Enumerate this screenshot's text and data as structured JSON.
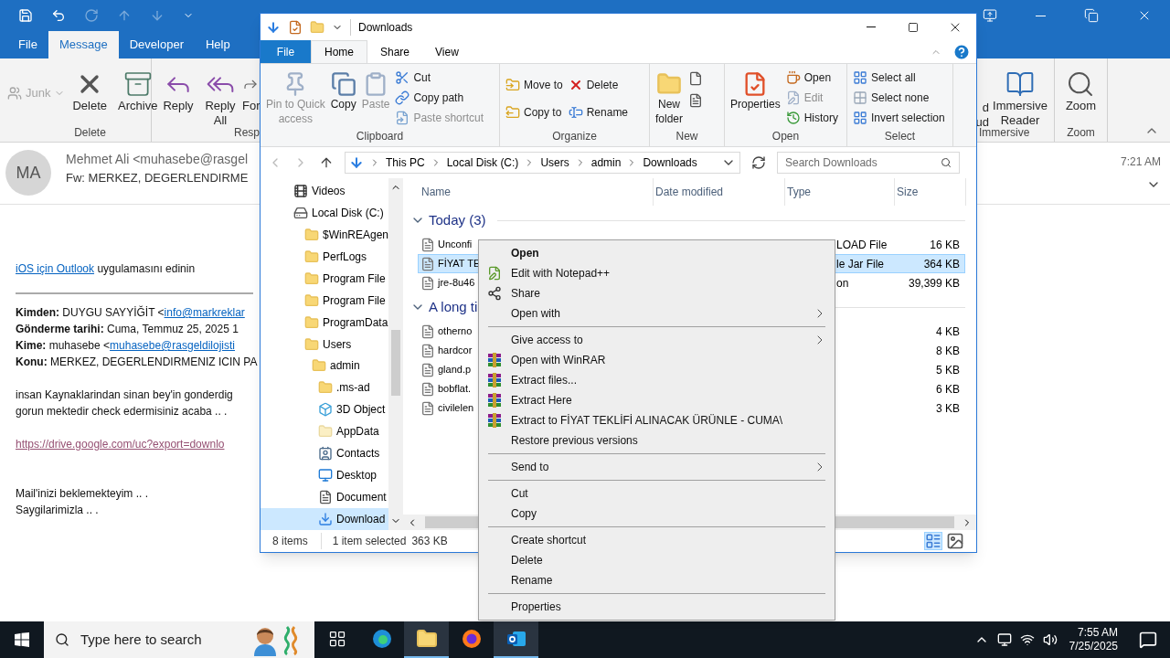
{
  "outlook": {
    "tabs": [
      {
        "label": "File",
        "selected": false
      },
      {
        "label": "Message",
        "selected": true
      },
      {
        "label": "Developer",
        "selected": false
      },
      {
        "label": "Help",
        "selected": false
      }
    ],
    "junk": {
      "label": "Junk",
      "disabled": true
    },
    "delete_group": {
      "buttons": [
        {
          "lines": [
            "Delete"
          ]
        },
        {
          "lines": [
            "Archive"
          ]
        }
      ],
      "label": "Delete"
    },
    "respond_group": {
      "buttons": [
        {
          "lines": [
            "Reply"
          ]
        },
        {
          "lines": [
            "Reply",
            "All"
          ]
        },
        {
          "lines": [
            "For"
          ]
        }
      ],
      "label": "Resp"
    },
    "immersive_group": {
      "buttons": [
        {
          "lines": [
            "d",
            "ud"
          ]
        },
        {
          "lines": [
            "Immersive",
            "Reader"
          ]
        }
      ],
      "label": "Immersive"
    },
    "zoom_group": {
      "buttons": [
        {
          "lines": [
            "Zoom"
          ]
        }
      ],
      "label": "Zoom"
    },
    "message": {
      "avatar": "MA",
      "from": "Mehmet Ali <muhasebe@rasgel",
      "subject": "Fw: MERKEZ, DEGERLENDIRME",
      "time": "7:21 AM"
    },
    "body": {
      "app_link": "iOS için Outlook",
      "app_text": " uygulamasını edinin",
      "headers": [
        {
          "label": "Kimden:",
          "text": " DUYGU SAYYİĞİT <",
          "link": "info@markreklar"
        },
        {
          "label": "Gönderme tarihi:",
          "text": " Cuma, Temmuz 25, 2025 1"
        },
        {
          "label": "Kime:",
          "text": " muhasebe <",
          "link": "muhasebe@rasgeldilojisti"
        },
        {
          "label": "Konu:",
          "text": " MERKEZ, DEGERLENDIRMENIZ ICIN PA"
        }
      ],
      "paragraph": [
        "insan Kaynaklarindan sinan bey'in gonderdig",
        "gorun mektedir check edermisiniz acaba .. ."
      ],
      "url": "https://drive.google.com/uc?export=downlo",
      "closing": [
        "Mail'inizi beklemekteyim .. .",
        "Saygilarimizla .. ."
      ]
    }
  },
  "explorer": {
    "title": "Downloads",
    "file_menu": "File",
    "tabs": [
      {
        "label": "Home",
        "selected": true
      },
      {
        "label": "Share",
        "selected": false
      },
      {
        "label": "View",
        "selected": false
      }
    ],
    "clipboard": {
      "label": "Clipboard",
      "large": [
        {
          "lines": [
            "Pin to Quick",
            "access"
          ],
          "disabled": true
        },
        {
          "lines": [
            "Copy"
          ],
          "disabled": false
        },
        {
          "lines": [
            "Paste"
          ],
          "disabled": true
        }
      ],
      "small": [
        {
          "label": "Cut",
          "disabled": false
        },
        {
          "label": "Copy path",
          "disabled": false
        },
        {
          "label": "Paste shortcut",
          "disabled": true
        }
      ]
    },
    "organize": {
      "label": "Organize",
      "small": [
        {
          "label": "Move to",
          "disabled": false
        },
        {
          "label": "Copy to",
          "disabled": false
        },
        {
          "label": "Delete",
          "disabled": false
        },
        {
          "label": "Rename",
          "disabled": false
        }
      ]
    },
    "new": {
      "label": "New",
      "button": [
        "New",
        "folder"
      ]
    },
    "open": {
      "label": "Open",
      "button": [
        "Properties"
      ],
      "small": [
        {
          "label": "Open",
          "disabled": false
        },
        {
          "label": "Edit",
          "disabled": true
        },
        {
          "label": "History",
          "disabled": false
        }
      ]
    },
    "select": {
      "label": "Select",
      "small": [
        {
          "label": "Select all",
          "disabled": false
        },
        {
          "label": "Select none",
          "disabled": false
        },
        {
          "label": "Invert selection",
          "disabled": false
        }
      ]
    },
    "breadcrumb": [
      "This PC",
      "Local Disk (C:)",
      "Users",
      "admin",
      "Downloads"
    ],
    "search": {
      "placeholder": "Search Downloads"
    },
    "nav": [
      {
        "label": "Videos",
        "selected": false
      },
      {
        "label": "Local Disk (C:)",
        "selected": false,
        "children": [
          {
            "label": "$WinREAgen",
            "selected": false
          },
          {
            "label": "PerfLogs",
            "selected": false
          },
          {
            "label": "Program File",
            "selected": false
          },
          {
            "label": "Program File",
            "selected": false
          },
          {
            "label": "ProgramData",
            "selected": false
          },
          {
            "label": "Users",
            "selected": false,
            "children": [
              {
                "label": "admin",
                "selected": false,
                "children": [
                  {
                    "label": ".ms-ad",
                    "selected": false
                  },
                  {
                    "label": "3D Object",
                    "selected": false
                  },
                  {
                    "label": "AppData",
                    "selected": false
                  },
                  {
                    "label": "Contacts",
                    "selected": false
                  },
                  {
                    "label": "Desktop",
                    "selected": false
                  },
                  {
                    "label": "Document",
                    "selected": false
                  },
                  {
                    "label": "Download",
                    "selected": true
                  }
                ]
              }
            ]
          }
        ]
      }
    ],
    "columns": [
      "Name",
      "Date modified",
      "Type",
      "Size"
    ],
    "groups": [
      {
        "label": "Today (3)",
        "files": [
          {
            "name": "Unconfi",
            "type": "LOAD File",
            "size": "16 KB",
            "selected": false
          },
          {
            "name": "FİYAT TE",
            "type": "le Jar File",
            "size": "364 KB",
            "selected": true
          },
          {
            "name": "jre-8u46",
            "type": "on",
            "size": "39,399 KB",
            "selected": false
          }
        ]
      },
      {
        "label": "A long ti",
        "files": [
          {
            "name": "otherno",
            "size": "4 KB",
            "selected": false
          },
          {
            "name": "hardcor",
            "size": "8 KB",
            "selected": false
          },
          {
            "name": "gland.p",
            "size": "5 KB",
            "selected": false
          },
          {
            "name": "bobflat.",
            "size": "6 KB",
            "selected": false
          },
          {
            "name": "civilelen",
            "size": "3 KB",
            "selected": false
          }
        ]
      }
    ],
    "status": {
      "count": "8 items",
      "selection": "1 item selected",
      "size": "363 KB"
    }
  },
  "context_menu": [
    {
      "kind": "item",
      "label": "Open",
      "bold": true
    },
    {
      "kind": "item",
      "label": "Edit with Notepad++"
    },
    {
      "kind": "item",
      "label": "Share"
    },
    {
      "kind": "submenu",
      "label": "Open with"
    },
    {
      "kind": "separator"
    },
    {
      "kind": "submenu",
      "label": "Give access to"
    },
    {
      "kind": "item",
      "label": "Open with WinRAR"
    },
    {
      "kind": "item",
      "label": "Extract files..."
    },
    {
      "kind": "item",
      "label": "Extract Here"
    },
    {
      "kind": "item",
      "label": "Extract to FİYAT TEKLİFİ ALINACAK ÜRÜNLE - CUMA\\"
    },
    {
      "kind": "item",
      "label": "Restore previous versions"
    },
    {
      "kind": "separator"
    },
    {
      "kind": "submenu",
      "label": "Send to"
    },
    {
      "kind": "separator"
    },
    {
      "kind": "item",
      "label": "Cut"
    },
    {
      "kind": "item",
      "label": "Copy"
    },
    {
      "kind": "separator"
    },
    {
      "kind": "item",
      "label": "Create shortcut"
    },
    {
      "kind": "item",
      "label": "Delete"
    },
    {
      "kind": "item",
      "label": "Rename"
    },
    {
      "kind": "separator"
    },
    {
      "kind": "item",
      "label": "Properties"
    }
  ],
  "taskbar": {
    "search_placeholder": "Type here to search",
    "apps": [
      {
        "selected": false
      },
      {
        "selected": false
      },
      {
        "selected": true
      },
      {
        "selected": false
      },
      {
        "selected": true
      }
    ],
    "time": "7:55 AM",
    "date": "7/25/2025"
  }
}
